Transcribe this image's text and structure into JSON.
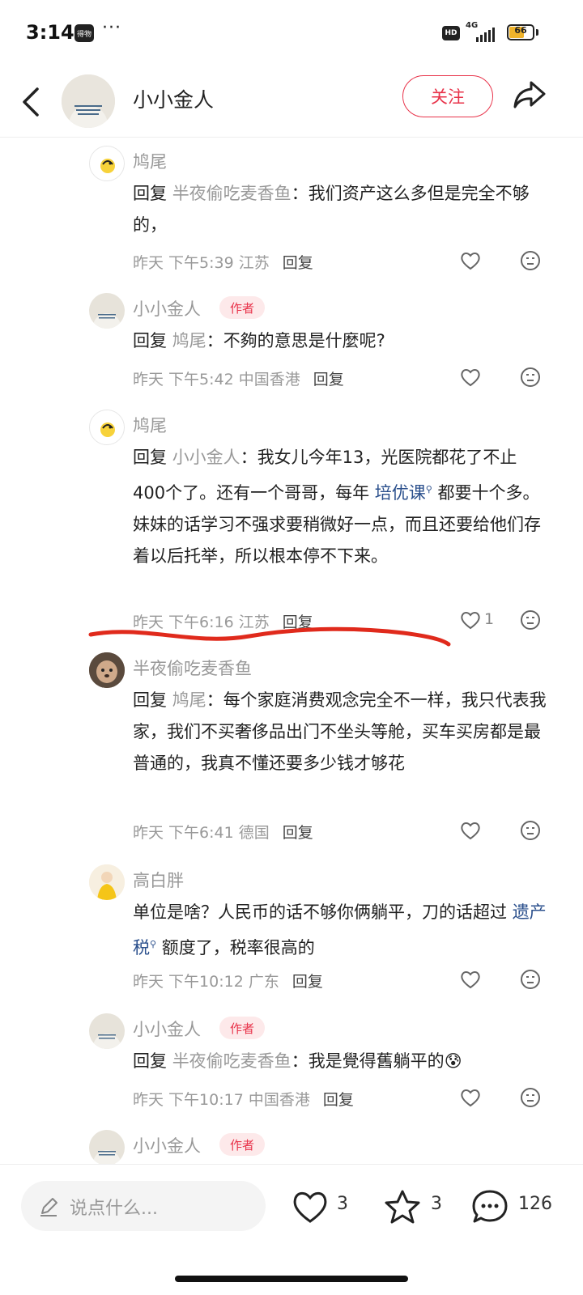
{
  "status_bar": {
    "time": "3:14",
    "app_badge": "得物",
    "more": "···",
    "hd": "HD",
    "network": "4G",
    "battery": "66"
  },
  "header": {
    "user_name": "小小金人",
    "follow_label": "关注"
  },
  "comments": [
    {
      "name": "鸠尾",
      "reply_prefix": "回复",
      "reply_to": "半夜偷吃麦香鱼",
      "colon": "：",
      "text1": "我们资产这么多但是完全不够的，",
      "time_loc": "昨天 下午5:39 江苏",
      "reply_label": "回复"
    },
    {
      "name": "小小金人",
      "badge": "作者",
      "reply_prefix": "回复",
      "reply_to": "鸠尾",
      "colon": "：",
      "text1": "不夠的意思是什麼呢?",
      "time_loc": "昨天 下午5:42 中国香港",
      "reply_label": "回复"
    },
    {
      "name": "鸠尾",
      "reply_prefix": "回复",
      "reply_to": "小小金人",
      "colon": "：",
      "text1": "我女儿今年13，光医院都花了不止400个了。还有一个哥哥，每年",
      "keyword": "培优课",
      "text2": "都要十个多。妹妹的话学习不强求要稍微好一点，而且还要给他们存着以后托举，所以根本停不下来。",
      "time_loc": "昨天 下午6:16 江苏",
      "reply_label": "回复",
      "likes": "1"
    },
    {
      "name": "半夜偷吃麦香鱼",
      "reply_prefix": "回复",
      "reply_to": "鸠尾",
      "colon": "：",
      "text1": "每个家庭消费观念完全不一样，我只代表我家，我们不买奢侈品出门不坐头等舱，买车买房都是最普通的，我真不懂还要多少钱才够花",
      "time_loc": "昨天 下午6:41 德国",
      "reply_label": "回复"
    },
    {
      "name": "高白胖",
      "text1": "单位是啥？人民币的话不够你俩躺平，刀的话超过",
      "keyword": "遗产税",
      "text2": "额度了，税率很高的",
      "time_loc": "昨天 下午10:12 广东",
      "reply_label": "回复"
    },
    {
      "name": "小小金人",
      "badge": "作者",
      "reply_prefix": "回复",
      "reply_to": "半夜偷吃麦香鱼",
      "colon": "：",
      "text1": "我是覺得舊躺平的",
      "emoji": "😰",
      "time_loc": "昨天 下午10:17 中国香港",
      "reply_label": "回复"
    },
    {
      "name": "小小金人",
      "badge": "作者"
    }
  ],
  "bottom_bar": {
    "input_placeholder": "说点什么...",
    "likes": "3",
    "stars": "3",
    "comments": "126"
  },
  "colors": {
    "accent_red": "#e8334a",
    "keyword_blue": "#2a4f8c",
    "meta_gray": "#999999"
  }
}
